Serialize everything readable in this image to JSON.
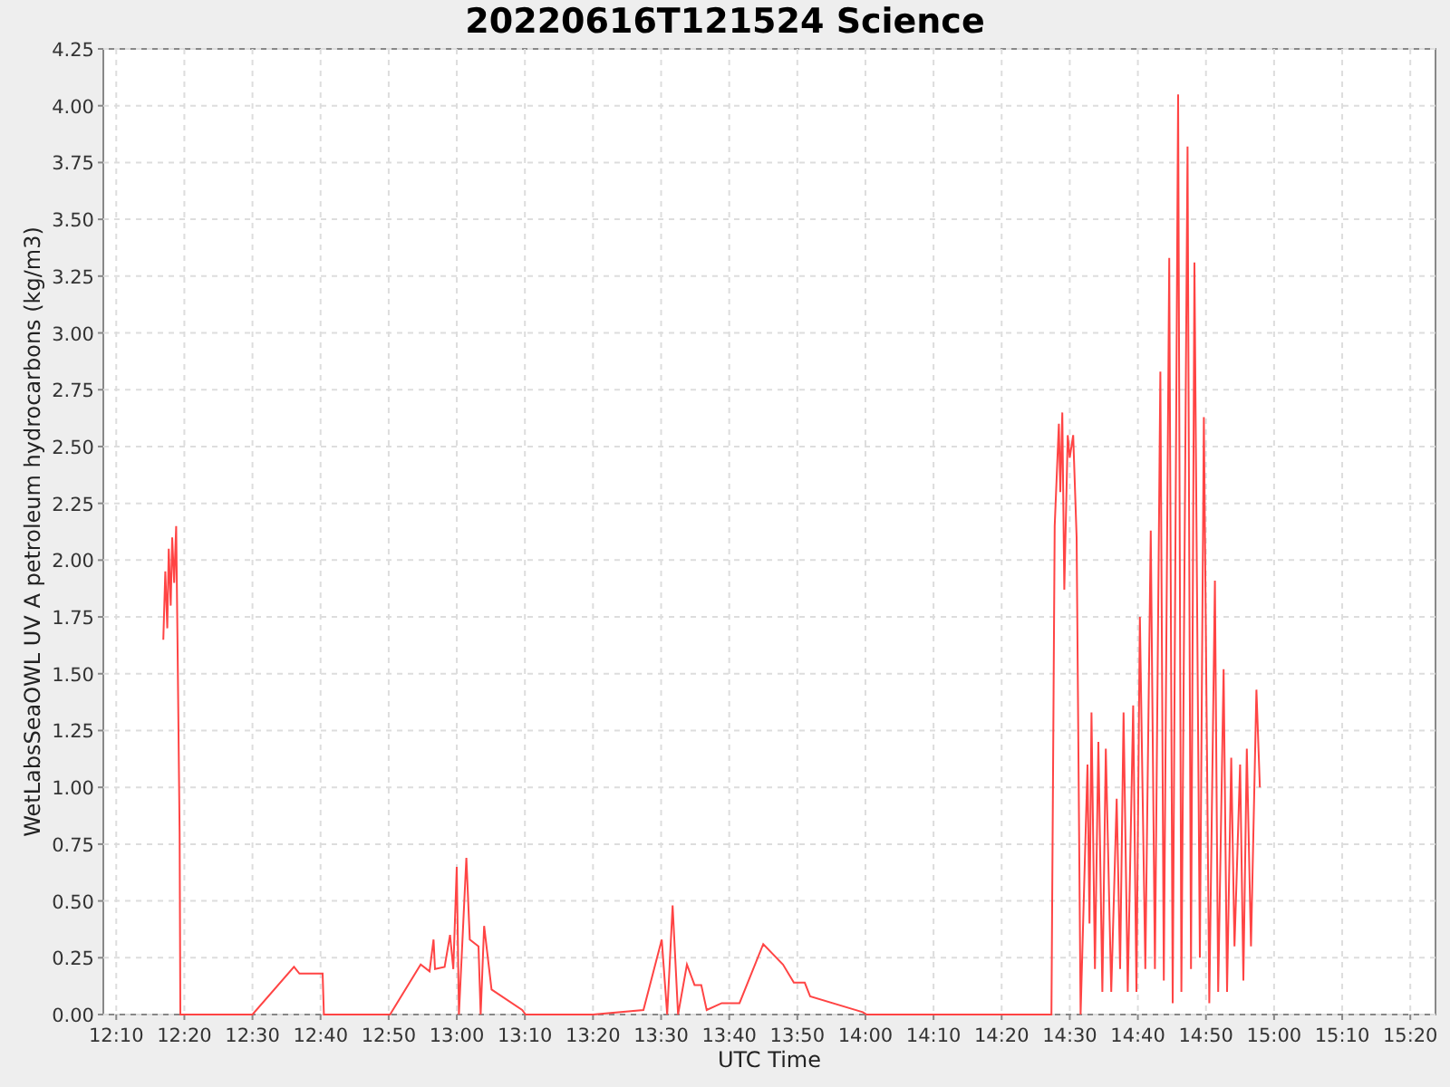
{
  "chart_data": {
    "type": "line",
    "title": "20220616T121524 Science",
    "xlabel": "UTC Time",
    "ylabel": "WetLabsSeaOWL UV A petroleum hydrocarbons (kg/m3)",
    "grid": true,
    "xlim": [
      728.1,
      923.7
    ],
    "ylim": [
      0,
      4.25
    ],
    "xticks": [
      {
        "value": 730,
        "label": "12:10"
      },
      {
        "value": 740,
        "label": "12:20"
      },
      {
        "value": 750,
        "label": "12:30"
      },
      {
        "value": 760,
        "label": "12:40"
      },
      {
        "value": 770,
        "label": "12:50"
      },
      {
        "value": 780,
        "label": "13:00"
      },
      {
        "value": 790,
        "label": "13:10"
      },
      {
        "value": 800,
        "label": "13:20"
      },
      {
        "value": 810,
        "label": "13:30"
      },
      {
        "value": 820,
        "label": "13:40"
      },
      {
        "value": 830,
        "label": "13:50"
      },
      {
        "value": 840,
        "label": "14:00"
      },
      {
        "value": 850,
        "label": "14:10"
      },
      {
        "value": 860,
        "label": "14:20"
      },
      {
        "value": 870,
        "label": "14:30"
      },
      {
        "value": 880,
        "label": "14:40"
      },
      {
        "value": 890,
        "label": "14:50"
      },
      {
        "value": 900,
        "label": "15:00"
      },
      {
        "value": 910,
        "label": "15:10"
      },
      {
        "value": 920,
        "label": "15:20"
      }
    ],
    "yticks": [
      {
        "value": 0,
        "label": "0.00"
      },
      {
        "value": 0.25,
        "label": "0.25"
      },
      {
        "value": 0.5,
        "label": "0.50"
      },
      {
        "value": 0.75,
        "label": "0.75"
      },
      {
        "value": 1,
        "label": "1.00"
      },
      {
        "value": 1.25,
        "label": "1.25"
      },
      {
        "value": 1.5,
        "label": "1.50"
      },
      {
        "value": 1.75,
        "label": "1.75"
      },
      {
        "value": 2,
        "label": "2.00"
      },
      {
        "value": 2.25,
        "label": "2.25"
      },
      {
        "value": 2.5,
        "label": "2.50"
      },
      {
        "value": 2.75,
        "label": "2.75"
      },
      {
        "value": 3,
        "label": "3.00"
      },
      {
        "value": 3.25,
        "label": "3.25"
      },
      {
        "value": 3.5,
        "label": "3.50"
      },
      {
        "value": 3.75,
        "label": "3.75"
      },
      {
        "value": 4,
        "label": "4.00"
      },
      {
        "value": 4.25,
        "label": "4.25"
      }
    ],
    "x": [
      736.9,
      737.2,
      737.5,
      737.7,
      738.0,
      738.2,
      738.5,
      738.8,
      739.0,
      739.3,
      739.4,
      750.0,
      756.1,
      756.9,
      760.3,
      760.5,
      770.2,
      774.7,
      776.0,
      776.6,
      776.8,
      778.2,
      779.0,
      779.5,
      780.0,
      780.3,
      781.4,
      781.9,
      783.2,
      783.5,
      784.0,
      785.1,
      789.6,
      790.1,
      800.0,
      807.4,
      810.1,
      810.9,
      811.7,
      812.5,
      813.8,
      814.9,
      815.9,
      816.7,
      818.9,
      821.5,
      825.0,
      827.9,
      829.5,
      831.1,
      831.9,
      839.6,
      840.2,
      867.3,
      867.8,
      868.4,
      868.6,
      868.9,
      869.2,
      869.7,
      870.0,
      870.5,
      871.0,
      871.6,
      872.6,
      872.9,
      873.2,
      873.7,
      874.2,
      874.8,
      875.3,
      876.1,
      876.9,
      877.4,
      877.9,
      878.5,
      879.3,
      879.8,
      880.3,
      881.1,
      881.9,
      882.5,
      883.3,
      883.8,
      884.6,
      885.1,
      885.9,
      886.4,
      887.3,
      887.8,
      888.3,
      889.1,
      889.7,
      890.5,
      891.3,
      891.8,
      892.6,
      893.1,
      893.7,
      894.2,
      895.0,
      895.5,
      896.0,
      896.6,
      897.4,
      897.9
    ],
    "series": [
      {
        "color": "#ff4444",
        "values": [
          1.65,
          1.95,
          1.7,
          2.05,
          1.8,
          2.1,
          1.9,
          2.15,
          1.6,
          0.8,
          0,
          0,
          0.21,
          0.18,
          0.18,
          0,
          0,
          0.22,
          0.19,
          0.33,
          0.2,
          0.21,
          0.35,
          0.2,
          0.65,
          0,
          0.69,
          0.33,
          0.3,
          0,
          0.39,
          0.11,
          0.02,
          0,
          0,
          0.02,
          0.33,
          0,
          0.48,
          0,
          0.22,
          0.13,
          0.13,
          0.02,
          0.05,
          0.05,
          0.31,
          0.22,
          0.14,
          0.14,
          0.08,
          0.01,
          0,
          0,
          2.15,
          2.6,
          2.3,
          2.65,
          1.87,
          2.55,
          2.45,
          2.55,
          2.1,
          0,
          1.1,
          0.4,
          1.33,
          0.2,
          1.2,
          0.1,
          1.17,
          0.1,
          0.95,
          0.2,
          1.33,
          0.1,
          1.36,
          0.1,
          1.75,
          0.2,
          2.13,
          0.2,
          2.83,
          0.15,
          3.33,
          0.05,
          4.05,
          0.1,
          3.82,
          0.2,
          3.31,
          0.25,
          2.63,
          0.05,
          1.91,
          0.1,
          1.52,
          0.1,
          1.13,
          0.3,
          1.1,
          0.15,
          1.17,
          0.3,
          1.43,
          1.0
        ]
      }
    ]
  }
}
